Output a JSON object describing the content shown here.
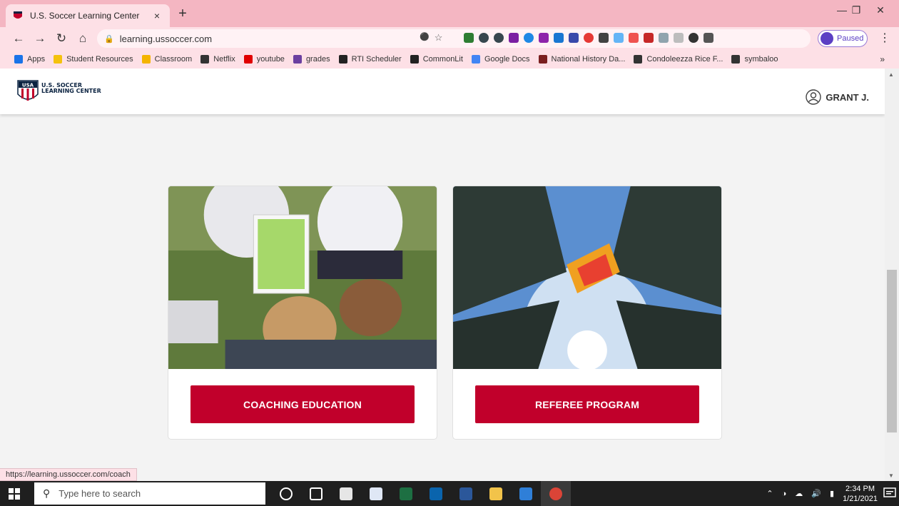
{
  "browser": {
    "tab_title": "U.S. Soccer Learning Center",
    "tab_close": "×",
    "new_tab": "+",
    "url": "learning.ussoccer.com",
    "profile_label": "Paused",
    "bookmarks": [
      {
        "label": "Apps",
        "color": "#1a73e8"
      },
      {
        "label": "Student Resources",
        "color": "#f4c20d"
      },
      {
        "label": "Classroom",
        "color": "#f4b400"
      },
      {
        "label": "Netflix",
        "color": "#333333"
      },
      {
        "label": "youtube",
        "color": "#e00000"
      },
      {
        "label": "grades",
        "color": "#6b3fa0"
      },
      {
        "label": "RTI Scheduler",
        "color": "#222222"
      },
      {
        "label": "CommonLit",
        "color": "#222222"
      },
      {
        "label": "Google Docs",
        "color": "#4285f4"
      },
      {
        "label": "National History Da...",
        "color": "#7a1f1f"
      },
      {
        "label": "Condoleezza Rice F...",
        "color": "#333333"
      },
      {
        "label": "symbaloo",
        "color": "#333333"
      }
    ],
    "bookmarks_more": "»",
    "status_url": "https://learning.ussoccer.com/coach"
  },
  "site": {
    "logo_line1": "U.S. SOCCER",
    "logo_line2": "LEARNING CENTER",
    "user_name": "GRANT J.",
    "accent": "#c1002b",
    "cards": [
      {
        "button_label": "COACHING EDUCATION"
      },
      {
        "button_label": "REFEREE PROGRAM"
      }
    ]
  },
  "taskbar": {
    "search_placeholder": "Type here to search",
    "time": "2:34 PM",
    "date": "1/21/2021"
  }
}
